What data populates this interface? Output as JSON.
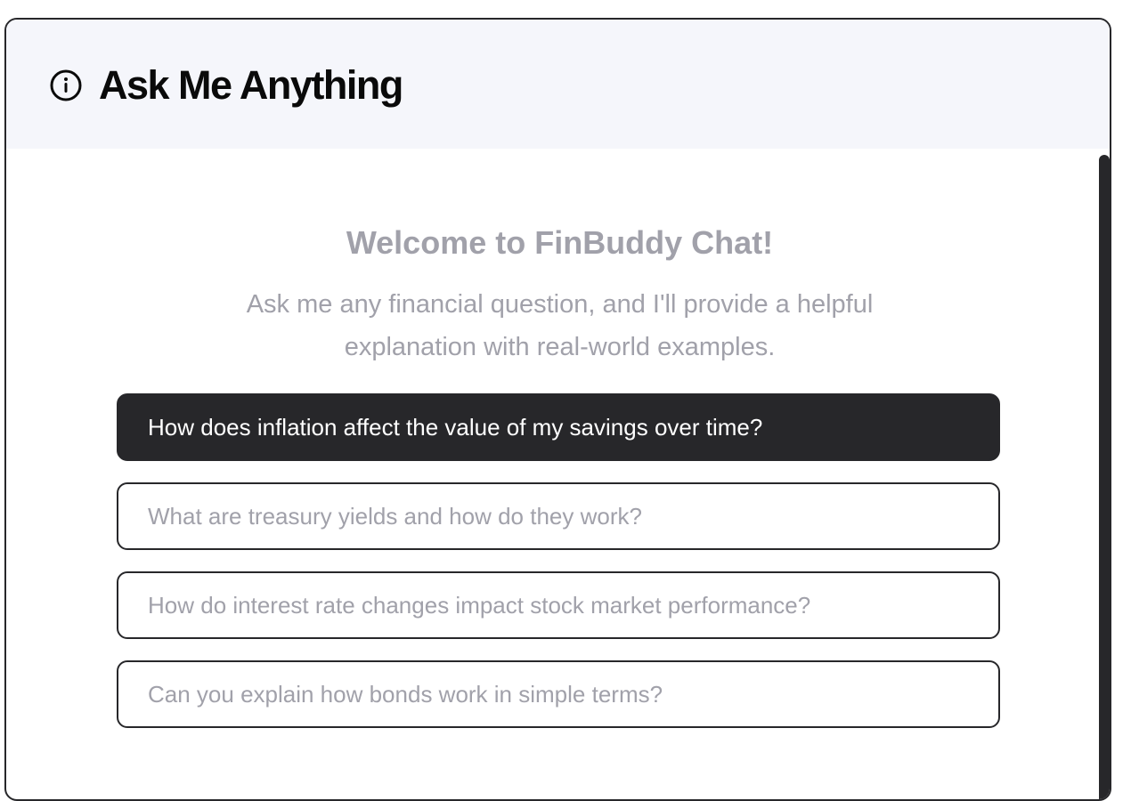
{
  "header": {
    "icon": "info-icon",
    "title": "Ask Me Anything"
  },
  "welcome": {
    "title": "Welcome to FinBuddy Chat!",
    "text": "Ask me any financial question, and I'll provide a helpful explanation with real-world examples."
  },
  "suggestions": [
    {
      "label": "How does inflation affect the value of my savings over time?",
      "state": "selected"
    },
    {
      "label": "What are treasury yields and how do they work?",
      "state": "default"
    },
    {
      "label": "How do interest rate changes impact stock market performance?",
      "state": "default"
    },
    {
      "label": "Can you explain how bonds work in simple terms?",
      "state": "default"
    }
  ],
  "colors": {
    "header_background": "#f5f6fb",
    "accent_dark": "#27272a",
    "muted_text": "#a1a1aa"
  }
}
